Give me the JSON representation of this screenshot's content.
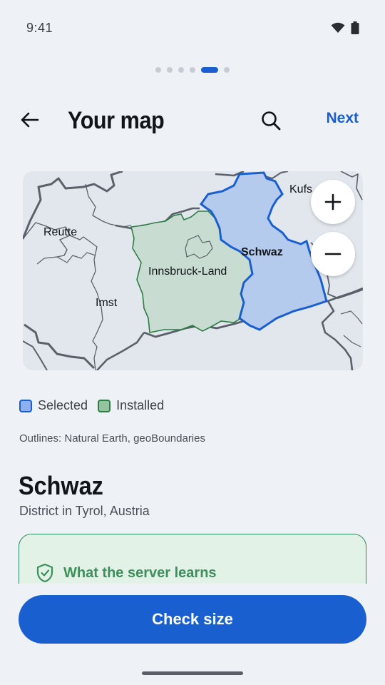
{
  "status": {
    "time": "9:41",
    "wifi_icon": "wifi-icon",
    "battery_icon": "battery-icon"
  },
  "pager": {
    "total": 6,
    "active": 5
  },
  "header": {
    "title": "Your map",
    "next_label": "Next",
    "back_icon": "arrow-left-icon",
    "search_icon": "search-icon"
  },
  "map": {
    "labels": {
      "reutte": "Reutte",
      "imst": "Imst",
      "innsbruck": "Innsbruck-Land",
      "schwaz": "Schwaz",
      "kufstein": "Kufs"
    },
    "zoom_in_icon": "plus-icon",
    "zoom_out_icon": "minus-icon",
    "colors": {
      "selected_fill": "#b5cbee",
      "selected_stroke": "#1a5fcf",
      "installed_fill": "#c9dcd1",
      "installed_stroke": "#2e7d46",
      "background": "#e1e7ec",
      "border_line": "#5b6168"
    }
  },
  "legend": {
    "selected": "Selected",
    "installed": "Installed"
  },
  "attribution": "Outlines: Natural Earth, geoBoundaries",
  "region": {
    "name": "Schwaz",
    "subtitle": "District in Tyrol, Austria"
  },
  "info_card": {
    "title": "What the server learns",
    "icon": "shield-check-icon"
  },
  "primary_button": {
    "label": "Check size"
  },
  "accent": "#1a5fcf"
}
